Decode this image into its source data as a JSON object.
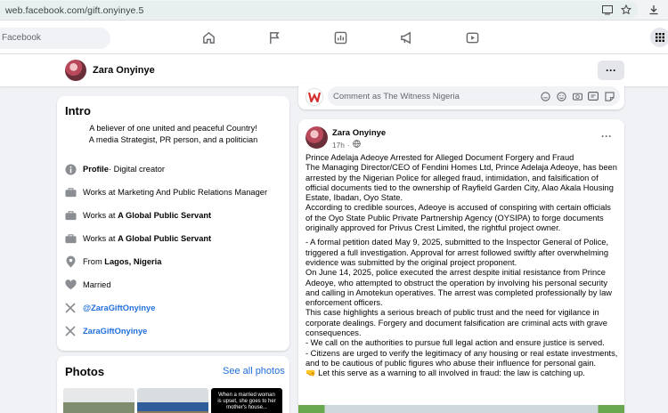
{
  "browser": {
    "url": "web.facebook.com/gift.onyinye.5"
  },
  "nav": {
    "search_placeholder": "Facebook"
  },
  "profile": {
    "name": "Zara Onyinye"
  },
  "intro": {
    "title": "Intro",
    "bio_line1": "A believer of one united and peaceful Country!",
    "bio_line2": "A media Strategist, PR person, and a politician",
    "profile_label": "Profile",
    "profile_type": " · Digital creator",
    "work1": "Works at Marketing And Public Relations Manager",
    "work2_prefix": "Works at ",
    "work2_org": "A Global Public Servant",
    "work3_prefix": "Works at ",
    "work3_org": "A Global Public Servant",
    "from_prefix": "From ",
    "from_place": "Lagos, Nigeria",
    "relationship": "Married",
    "twitter": "@ZaraGiftOnyinye",
    "link2": "ZaraGiftOnyinye"
  },
  "photos": {
    "title": "Photos",
    "see_all": "See all photos",
    "thumb3_text": "When a married woman is upset, she goes to her mother's house..."
  },
  "comment": {
    "placeholder": "Comment as The Witness Nigeria"
  },
  "post": {
    "author": "Zara Onyinye",
    "time": "17h",
    "paragraphs": [
      "Prince Adelaja Adeoye Arrested for Alleged Document Forgery and Fraud",
      "The Managing Director/CEO of Fendini Homes Ltd, Prince Adelaja Adeoye, has been arrested by the Nigerian Police for alleged fraud, intimidation, and falsification of official documents tied to the ownership of Rayfield Garden City, Alao Akala Housing Estate, Ibadan, Oyo State.",
      "According to credible sources, Adeoye is accused of conspiring with certain officials of the Oyo State Public Private Partnership Agency (OYSIPA) to forge documents originally approved for Privus Crest Limited, the rightful project owner.",
      "- A formal petition dated May 9, 2025, submitted to the Inspector General of Police, triggered a full investigation. Approval for arrest followed swiftly after overwhelming evidence was submitted by the original project proponent.",
      "On June 14, 2025, police executed the arrest despite initial resistance from Prince Adeoye, who attempted to obstruct the operation by involving his personal security and calling in Amotekun operatives. The arrest was completed professionally by law enforcement officers.",
      "This case highlights a serious breach of public trust and the need for vigilance in corporate dealings. Forgery and document falsification are criminal acts with grave consequences.",
      "- We call on the authorities to pursue full legal action and ensure justice is served.",
      "- Citizens are urged to verify the legitimacy of any housing or real estate investments, and to be cautious of public figures who abuse their influence for personal gain.",
      "🤜 Let this serve as a warning to all involved in fraud: the law is catching up."
    ]
  },
  "colors": {
    "link": "#216fdb",
    "background": "#f0f2f5",
    "card": "#ffffff"
  },
  "icons": [
    "cast-icon",
    "star-icon",
    "download-icon",
    "home-icon",
    "flag-icon",
    "dashboard-icon",
    "megaphone-icon",
    "video-icon",
    "apps-grid-icon",
    "info-icon",
    "briefcase-icon",
    "location-icon",
    "heart-icon",
    "x-logo-icon",
    "globe-icon",
    "sticker-icon",
    "emoji-icon",
    "camera-icon",
    "gif-icon"
  ]
}
